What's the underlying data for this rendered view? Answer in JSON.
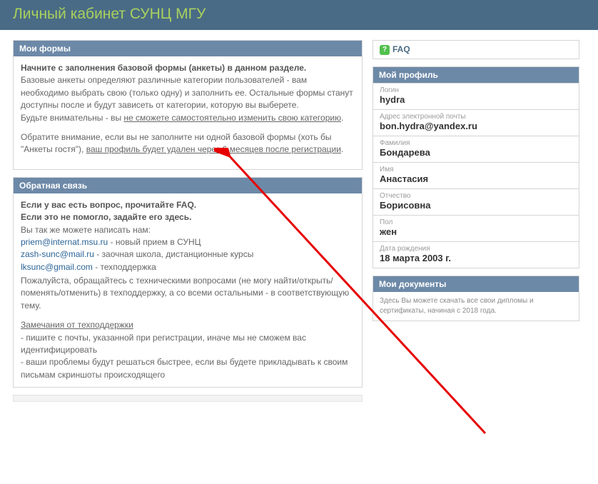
{
  "page_title": "Личный кабинет СУНЦ МГУ",
  "forms_panel": {
    "title": "Мои формы",
    "lead": "Начните с заполнения базовой формы (анкеты) в данном разделе.",
    "p1_pre": "Базовые анкеты определяют различные категории пользователей - вам необходимо выбрать свою (только одну) и заполнить ее. Остальные формы станут доступны после и будут зависеть от категории, которую вы выберете.",
    "p1_warn_pre": "Будьте внимательны - вы ",
    "p1_warn_u": "не сможете самостоятельно изменить свою категорию",
    "p1_warn_post": ".",
    "p2_pre": "Обратите внимание, если вы не заполните ни одной базовой формы (хоть бы \"Анкеты гостя\"), ",
    "p2_u": "ваш профиль будет удален через 6 месяцев после регистрации",
    "p2_post": "."
  },
  "feedback_panel": {
    "title": "Обратная связь",
    "lead1": "Если у вас есть вопрос, прочитайте FAQ.",
    "lead2": "Если это не помогло, задайте его здесь.",
    "also": "Вы так же можете написать нам:",
    "email1": "priem@internat.msu.ru",
    "email1_desc": " - новый прием в СУНЦ",
    "email2": "zash-sunc@mail.ru",
    "email2_desc": " - заочная школа, дистанционные курсы",
    "email3": "lksunc@gmail.com",
    "email3_desc": " - техподдержка",
    "p3": "Пожалуйста, обращайтесь с техническими вопросами (не могу найти/открыть/поменять/отменить) в техподдержку, а со всеми остальными - в соответствующую тему.",
    "notes_title": "Замечания от техподдержки",
    "note1": "- пишите с почты, указанной при регистрации, иначе мы не сможем вас идентифицировать",
    "note2": "- ваши проблемы будут решаться быстрее, если вы будете прикладывать к своим письмам скриншоты происходящего"
  },
  "faq": {
    "label": "FAQ"
  },
  "profile_panel": {
    "title": "Мой профиль"
  },
  "profile": {
    "login_label": "Логин",
    "login": "hydra",
    "email_label": "Адрес электронной почты",
    "email": "bon.hydra@yandex.ru",
    "lastname_label": "Фамилия",
    "lastname": "Бондарева",
    "firstname_label": "Имя",
    "firstname": "Анастасия",
    "patronymic_label": "Отчество",
    "patronymic": "Борисовна",
    "sex_label": "Пол",
    "sex": "жен",
    "dob_label": "Дата рождения",
    "dob": "18 марта 2003 г."
  },
  "docs_panel": {
    "title": "Мои документы",
    "text": "Здесь Вы можете скачать все свои дипломы и сертификаты, начиная с 2018 года."
  }
}
